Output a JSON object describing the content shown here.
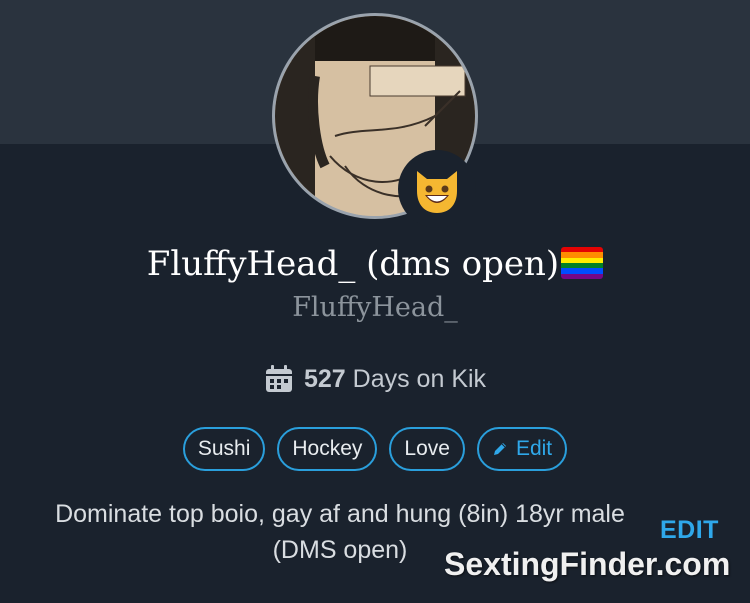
{
  "profile": {
    "display_name": "FluffyHead_ (dms open)",
    "username": "FluffyHead_",
    "days_count": "527",
    "days_label": "Days on Kik",
    "avatar_emoji": "😺",
    "name_emoji": "rainbow-flag",
    "tags": [
      "Sushi",
      "Hockey",
      "Love"
    ],
    "edit_tags_label": "Edit",
    "bio": "Dominate top boio, gay af and hung (8in) 18yr male (DMS open)",
    "edit_label": "EDIT"
  },
  "watermark": "SextingFinder.com",
  "colors": {
    "background": "#1a222d",
    "top_band": "#2a333e",
    "accent": "#2a9fdc",
    "text_muted": "#8c949c"
  }
}
